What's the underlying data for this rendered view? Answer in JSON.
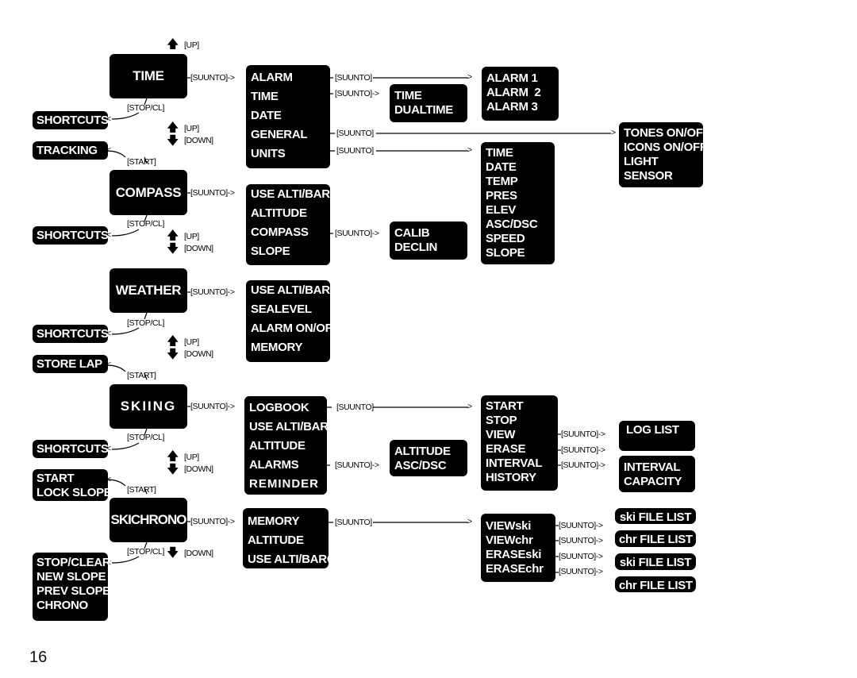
{
  "page_number": "16",
  "colors": {
    "box": "#000000",
    "box_text": "#ffffff",
    "line": "#000000",
    "background": "#ffffff"
  },
  "keys": {
    "up": "[UP]",
    "down": "[DOWN]",
    "suunto": "[SUUNTO]",
    "stop_cl": "[STOP/CL]",
    "start": "[START]"
  },
  "icons": {
    "up_arrow": "up-arrow-icon",
    "down_arrow": "down-arrow-icon"
  },
  "modes": [
    {
      "id": "time",
      "label": "TIME",
      "stop_cl_target": [
        "SHORTCUTS"
      ],
      "start_target": [
        "TRACKING"
      ],
      "submenu": [
        "ALARM",
        "TIME",
        "DATE",
        "GENERAL",
        "UNITS"
      ],
      "branches": [
        {
          "from": "ALARM",
          "items": [
            "ALARM 1",
            "ALARM  2",
            "ALARM 3"
          ]
        },
        {
          "from": "TIME",
          "items": [
            "TIME",
            "DUALTIME"
          ]
        },
        {
          "from": "GENERAL",
          "items": [
            "TONES ON/OFF",
            "ICONS ON/OFF",
            "LIGHT",
            "SENSOR"
          ]
        },
        {
          "from": "UNITS",
          "items": [
            "TIME",
            "DATE",
            "TEMP",
            "PRES",
            "ELEV",
            "ASC/DSC",
            "SPEED",
            "SLOPE"
          ]
        }
      ]
    },
    {
      "id": "compass",
      "label": "COMPASS",
      "stop_cl_target": [
        "SHORTCUTS"
      ],
      "submenu": [
        "USE ALTI/BARO",
        "ALTITUDE",
        "COMPASS",
        "SLOPE"
      ],
      "branches": [
        {
          "from": "COMPASS",
          "items": [
            "CALIB",
            "DECLIN"
          ]
        }
      ]
    },
    {
      "id": "weather",
      "label": "WEATHER",
      "stop_cl_target": [
        "SHORTCUTS"
      ],
      "start_target": [
        "STORE LAP"
      ],
      "submenu": [
        "USE ALTI/BARO",
        "SEALEVEL",
        "ALARM ON/OFF",
        "MEMORY"
      ]
    },
    {
      "id": "skiing",
      "label": "SKIING",
      "stop_cl_target": [
        "SHORTCUTS"
      ],
      "start_target": [
        "START",
        "LOCK SLOPE"
      ],
      "submenu": [
        "LOGBOOK",
        "USE ALTI/BARO",
        "ALTITUDE",
        "ALARMS",
        "REMINDER"
      ],
      "branches": [
        {
          "from": "LOGBOOK",
          "items": [
            "START",
            "STOP",
            "VIEW",
            "ERASE",
            "INTERVAL",
            "HISTORY"
          ]
        },
        {
          "from": "ALARMS",
          "items": [
            "ALTITUDE",
            "ASC/DSC"
          ]
        },
        {
          "from": "VIEW",
          "items": [
            "LOG LIST"
          ]
        },
        {
          "from": "INTERVAL",
          "items": [
            "INTERVAL",
            "CAPACITY"
          ]
        }
      ]
    },
    {
      "id": "skichrono",
      "label": "SKICHRONO",
      "stop_cl_target": [
        "STOP/CLEAR",
        "NEW SLOPE",
        "PREV SLOPE",
        "CHRONO"
      ],
      "submenu": [
        "MEMORY",
        "ALTITUDE",
        "USE ALTI/BARO"
      ],
      "branches": [
        {
          "from": "MEMORY",
          "items": [
            "VIEWski",
            "VIEWchr",
            "ERASEski",
            "ERASEchr"
          ]
        },
        {
          "from": "VIEWski",
          "items": [
            "ski FILE LIST"
          ]
        },
        {
          "from": "VIEWchr",
          "items": [
            "chr FILE LIST"
          ]
        },
        {
          "from": "ERASEski",
          "items": [
            "ski FILE LIST"
          ]
        },
        {
          "from": "ERASEchr",
          "items": [
            "chr FILE LIST"
          ]
        }
      ]
    }
  ]
}
